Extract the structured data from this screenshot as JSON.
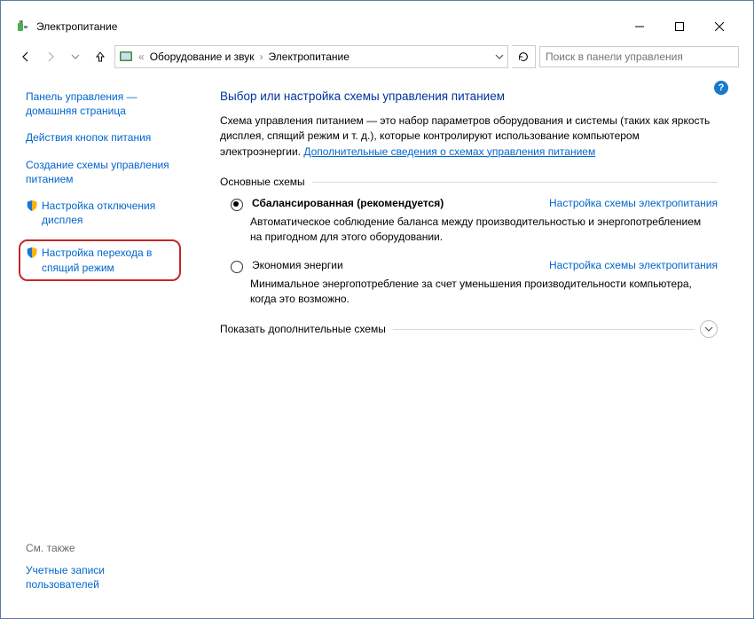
{
  "window": {
    "title": "Электропитание"
  },
  "addressbar": {
    "crumb1": "Оборудование и звук",
    "crumb2": "Электропитание",
    "search_placeholder": "Поиск в панели управления"
  },
  "sidebar": {
    "home": "Панель управления — домашняя страница",
    "items": [
      "Действия кнопок питания",
      "Создание схемы управления питанием",
      "Настройка отключения дисплея",
      "Настройка перехода в спящий режим"
    ],
    "see_also_label": "См. также",
    "see_also_item": "Учетные записи пользователей"
  },
  "main": {
    "title": "Выбор или настройка схемы управления питанием",
    "description": "Схема управления питанием — это набор параметров оборудования и системы (таких как яркость дисплея, спящий режим и т. д.), которые контролируют использование компьютером электроэнергии. ",
    "info_link": "Дополнительные сведения о схемах управления питанием",
    "group_label": "Основные схемы",
    "plans": [
      {
        "label": "Сбалансированная (рекомендуется)",
        "settings_link": "Настройка схемы электропитания",
        "desc": "Автоматическое соблюдение баланса между производительностью и энергопотреблением на пригодном для этого оборудовании."
      },
      {
        "label": "Экономия энергии",
        "settings_link": "Настройка схемы электропитания",
        "desc": "Минимальное энергопотребление за счет уменьшения производительности компьютера, когда это возможно."
      }
    ],
    "expand_label": "Показать дополнительные схемы"
  }
}
